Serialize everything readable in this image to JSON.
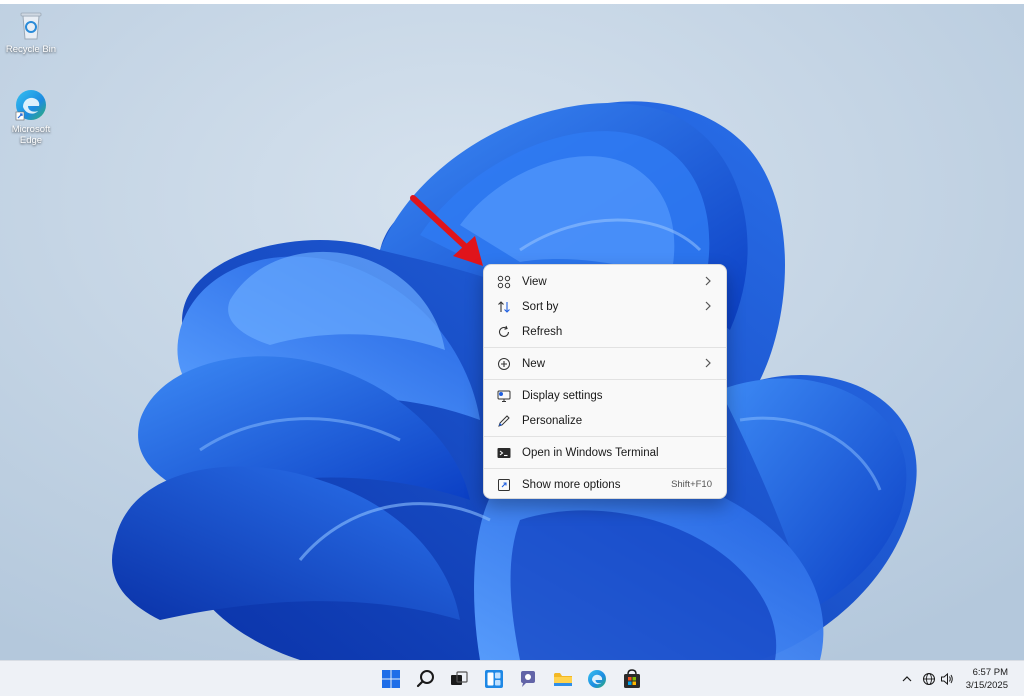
{
  "desktop": {
    "icons": [
      {
        "label": "Recycle Bin",
        "icon": "recycle-bin-icon"
      },
      {
        "label": "Microsoft Edge",
        "icon": "edge-icon"
      }
    ]
  },
  "context_menu": {
    "items": [
      {
        "label": "View",
        "icon": "view-grid-icon",
        "submenu": true
      },
      {
        "label": "Sort by",
        "icon": "sort-icon",
        "submenu": true
      },
      {
        "label": "Refresh",
        "icon": "refresh-icon"
      },
      {
        "label": "New",
        "icon": "new-plus-icon",
        "submenu": true
      },
      {
        "label": "Display settings",
        "icon": "display-settings-icon"
      },
      {
        "label": "Personalize",
        "icon": "personalize-pen-icon"
      },
      {
        "label": "Open in Windows Terminal",
        "icon": "terminal-icon"
      },
      {
        "label": "Show more options",
        "icon": "more-options-icon",
        "shortcut": "Shift+F10"
      }
    ]
  },
  "taskbar": {
    "apps": [
      "start-icon",
      "search-icon",
      "task-view-icon",
      "widgets-icon",
      "teams-chat-icon",
      "file-explorer-icon",
      "edge-icon",
      "store-icon"
    ],
    "tray": [
      "chevron-up-icon",
      "network-icon",
      "volume-icon"
    ],
    "time": "6:57 PM",
    "date": "3/15/2025"
  },
  "colors": {
    "accent_blue": "#1f5fe0",
    "arrow_red": "#e0141b"
  }
}
